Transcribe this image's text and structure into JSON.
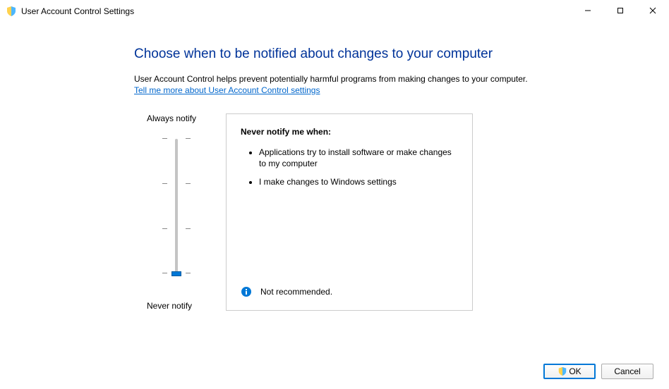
{
  "window": {
    "title": "User Account Control Settings"
  },
  "main": {
    "heading": "Choose when to be notified about changes to your computer",
    "description": "User Account Control helps prevent potentially harmful programs from making changes to your computer.",
    "link_text": "Tell me more about User Account Control settings"
  },
  "slider": {
    "top_label": "Always notify",
    "bottom_label": "Never notify",
    "levels": 4,
    "current_level": 0
  },
  "detail": {
    "title": "Never notify me when:",
    "items": [
      "Applications try to install software or make changes to my computer",
      "I make changes to Windows settings"
    ],
    "recommendation": "Not recommended."
  },
  "buttons": {
    "ok": "OK",
    "cancel": "Cancel"
  }
}
